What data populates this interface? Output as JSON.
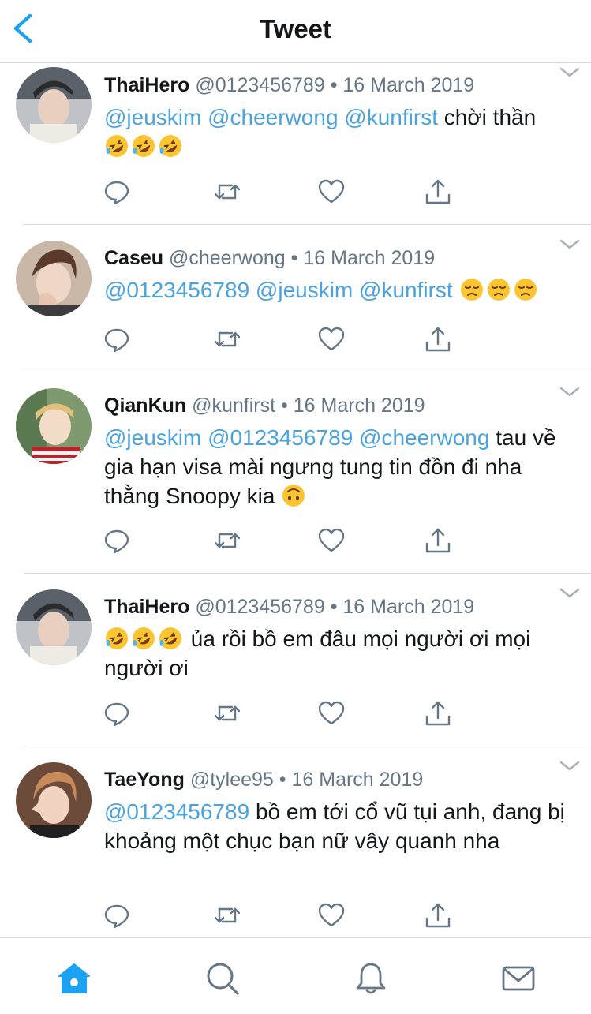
{
  "header": {
    "title": "Tweet",
    "back_icon": "chevron-left-icon"
  },
  "colors": {
    "accent": "#1da1f2",
    "mention": "#4aa3df",
    "text": "#14171a",
    "muted": "#657786",
    "divider": "#d6dadd",
    "icon": "#657786"
  },
  "tweets": [
    {
      "name": "ThaiHero",
      "handle": "@0123456789",
      "date": "16 March 2019",
      "mentions": "@jeuskim @cheerwong @kunfirst",
      "text": "chời thần",
      "emoji": [
        "rolling-on-floor-laughing",
        "rolling-on-floor-laughing",
        "rolling-on-floor-laughing"
      ]
    },
    {
      "name": "Caseu",
      "handle": "@cheerwong",
      "date": "16 March 2019",
      "mentions": "@0123456789 @jeuskim @kunfirst",
      "text": "",
      "emoji": [
        "disappointed-face",
        "disappointed-face",
        "disappointed-face"
      ]
    },
    {
      "name": "QianKun",
      "handle": "@kunfirst",
      "date": "16 March 2019",
      "mentions": "@jeuskim @0123456789 @cheerwong",
      "text": "tau về gia hạn visa mài ngưng tung tin đồn đi nha thằng Snoopy kia",
      "emoji": [
        "upside-down-face"
      ]
    },
    {
      "name": "ThaiHero",
      "handle": "@0123456789",
      "date": "16 March 2019",
      "mentions": "",
      "text": "ủa rồi bồ em đâu mọi người ơi mọi người ơi",
      "emoji": [
        "rolling-on-floor-laughing",
        "rolling-on-floor-laughing",
        "rolling-on-floor-laughing"
      ]
    },
    {
      "name": "TaeYong",
      "handle": "@tylee95",
      "date": "16 March 2019",
      "mentions": "@0123456789",
      "text": "bồ em tới cổ vũ tụi anh, đang bị khoảng một chục bạn nữ vây quanh nha",
      "emoji": []
    }
  ],
  "tweet_actions": [
    "reply-icon",
    "retweet-icon",
    "like-icon",
    "share-icon"
  ],
  "tabbar": {
    "items": [
      {
        "icon": "home-icon",
        "active": true
      },
      {
        "icon": "search-icon",
        "active": false
      },
      {
        "icon": "notifications-icon",
        "active": false
      },
      {
        "icon": "messages-icon",
        "active": false
      }
    ]
  }
}
